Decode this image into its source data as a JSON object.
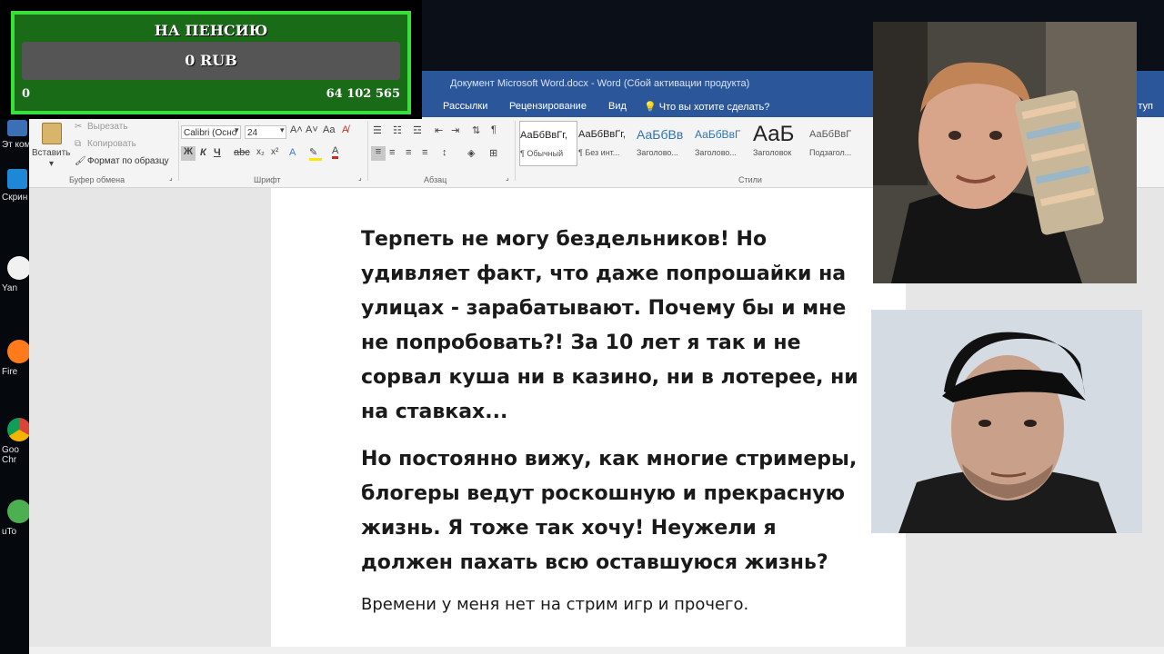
{
  "overlay": {
    "title": "НА ПЕНСИЮ",
    "amount": "0 RUB",
    "min": "0",
    "max": "64 102 565",
    "progress_fraction": 0.0,
    "colors": {
      "border": "#39e03a",
      "panel": "#1a6b18",
      "bar": "#555555"
    }
  },
  "desktop": {
    "icons": [
      {
        "label": "Эт\nкомпь",
        "icon": "computer-icon"
      },
      {
        "label": "Скрин",
        "icon": "screenshot-app-icon"
      },
      {
        "label": "Yan",
        "icon": "yandex-icon"
      },
      {
        "label": "Fire",
        "icon": "firefox-icon"
      },
      {
        "label": "Goo\nChr",
        "icon": "chrome-icon"
      },
      {
        "label": "uTo",
        "icon": "utorrent-icon"
      }
    ]
  },
  "word": {
    "title": "Документ Microsoft Word.docx - Word (Сбой активации продукта)",
    "tabs": [
      "Рассылки",
      "Рецензирование",
      "Вид"
    ],
    "tell_me": "Что вы хотите сделать?",
    "share_stub": "туп",
    "ribbon": {
      "clipboard": {
        "paste": "Вставить",
        "cut": "Вырезать",
        "copy": "Копировать",
        "format_painter": "Формат по образцу",
        "group_label": "Буфер обмена"
      },
      "font": {
        "font_name": "Calibri (Осно",
        "font_size": "24",
        "bold": "Ж",
        "italic": "К",
        "underline": "Ч",
        "group_label": "Шрифт"
      },
      "paragraph": {
        "group_label": "Абзац"
      },
      "styles": {
        "group_label": "Стили",
        "items": [
          {
            "preview": "АаБбВвГг,",
            "name": "¶ Обычный"
          },
          {
            "preview": "АаБбВвГг,",
            "name": "¶ Без инт..."
          },
          {
            "preview": "АаБбВв",
            "name": "Заголово..."
          },
          {
            "preview": "АаБбВвГ",
            "name": "Заголово..."
          },
          {
            "preview": "АаБ",
            "name": "Заголовок"
          },
          {
            "preview": "АаБбВвГ",
            "name": "Подзагол..."
          }
        ]
      }
    },
    "document": {
      "paragraphs": [
        "Терпеть не могу бездельников! Но удивляет факт, что даже попрошайки на улицах - зарабатывают. Почему бы и мне не попробовать?! За 10 лет я так и не сорвал куша ни в казино, ни в лотерее, ни на ставках...",
        "Но постоянно вижу, как многие стримеры, блогеры ведут роскошную и прекрасную жизнь. Я тоже так хочу! Неужели я должен пахать всю оставшуюся жизнь?",
        "Времени у меня нет на стрим игр и прочего."
      ]
    },
    "colors": {
      "title_bar": "#2b579a",
      "ribbon": "#f4f4f4",
      "workspace": "#e6e6e6"
    }
  }
}
